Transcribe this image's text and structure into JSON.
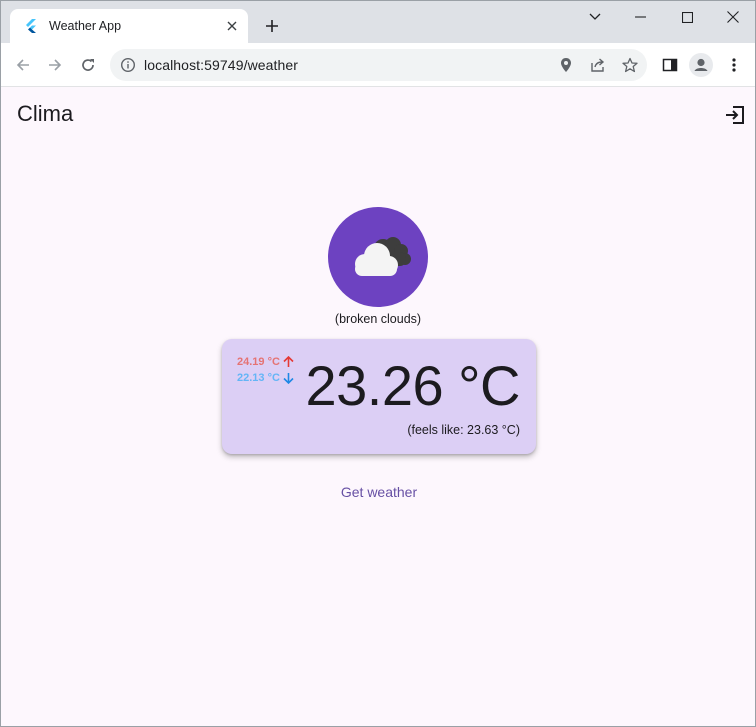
{
  "browser": {
    "tab_title": "Weather App",
    "url": "localhost:59749/weather"
  },
  "app": {
    "title": "Clima",
    "description": "(broken clouds)",
    "temp_max": "24.19 °C",
    "temp_min": "22.13 °C",
    "temperature": "23.26 °C",
    "feels_like": "(feels like: 23.63 °C)",
    "button_label": "Get weather"
  },
  "colors": {
    "app_background": "#fdf7fd",
    "icon_circle": "#6d42c1",
    "card": "#dccff5",
    "max_color": "#e57373",
    "min_color": "#64b5f6",
    "accent": "#6750a4"
  },
  "icons": {
    "weather": "broken-clouds-icon",
    "appbar_action": "logout-icon"
  }
}
